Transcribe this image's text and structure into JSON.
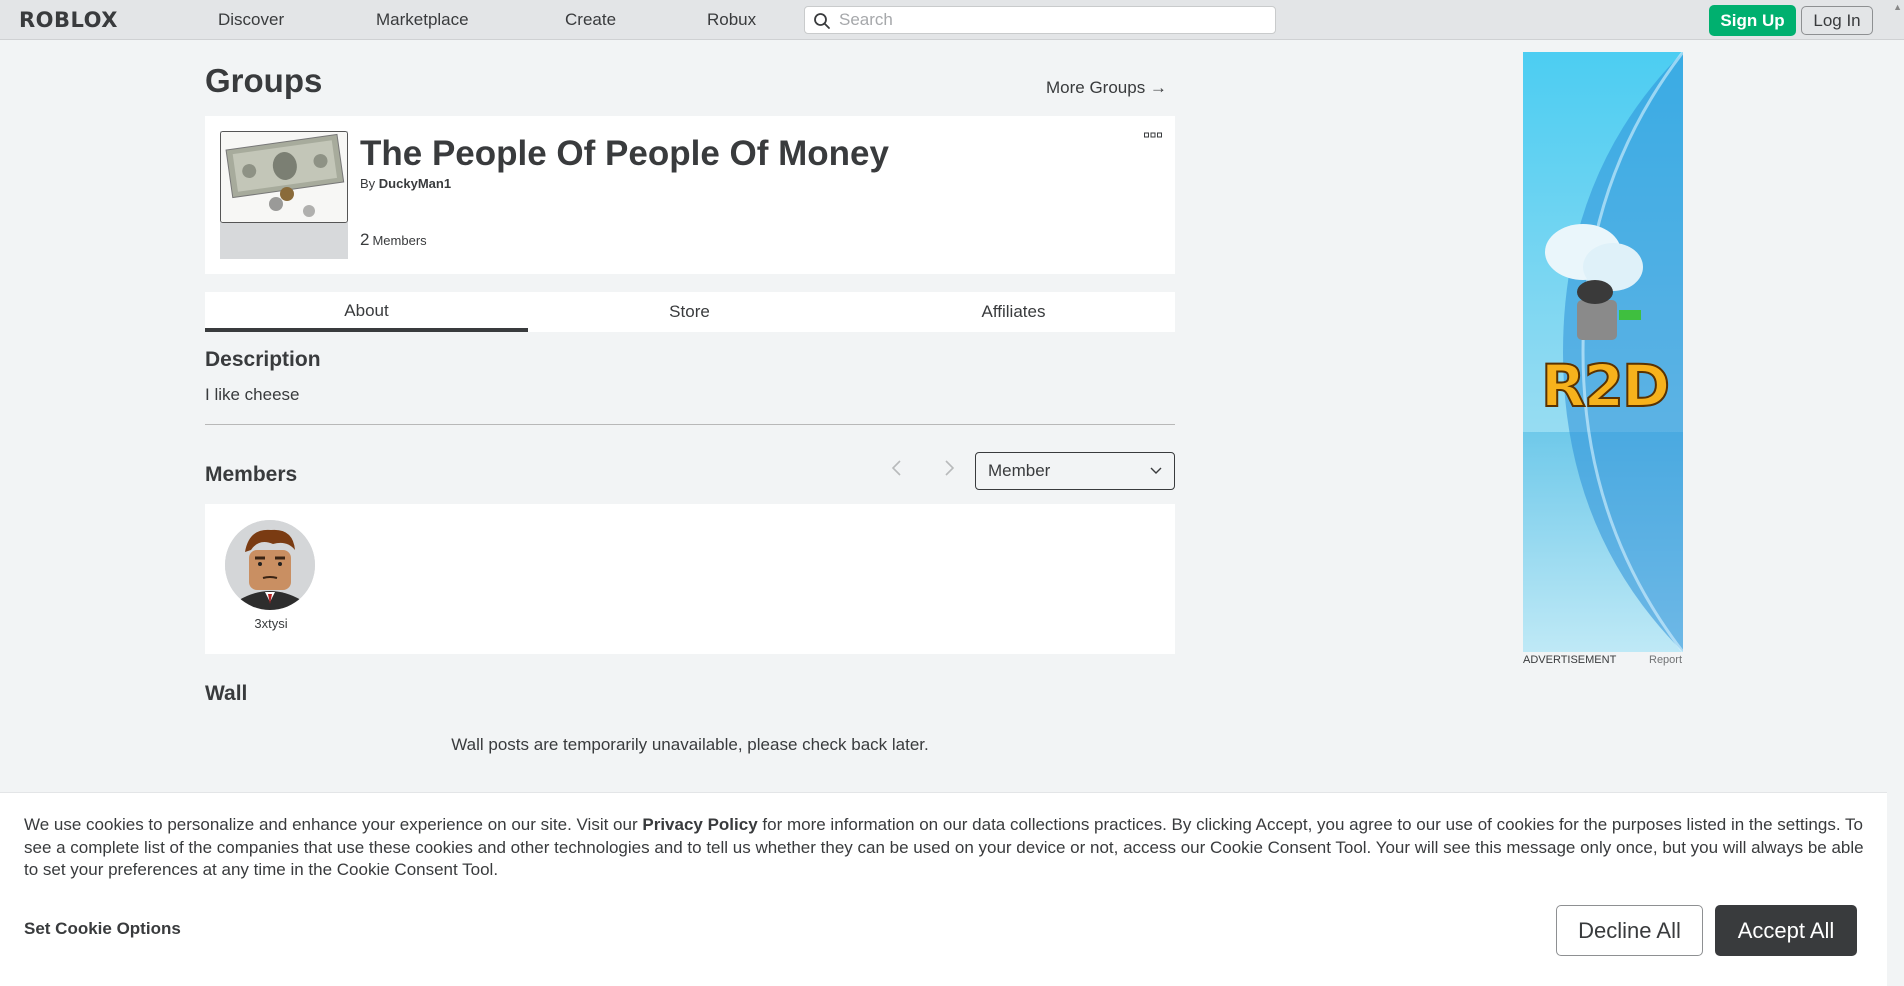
{
  "topnav": {
    "logo": "ROBLOX",
    "links": [
      "Discover",
      "Marketplace",
      "Create",
      "Robux"
    ],
    "search_placeholder": "Search",
    "signup_label": "Sign Up",
    "login_label": "Log In"
  },
  "page": {
    "title": "Groups",
    "more_groups": "More Groups →"
  },
  "group": {
    "name": "The People Of People Of Money",
    "by_prefix": "By",
    "owner": "DuckyMan1",
    "member_count": "2",
    "member_label": "Members"
  },
  "tabs": [
    "About",
    "Store",
    "Affiliates"
  ],
  "about": {
    "description_heading": "Description",
    "description_text": "I like cheese",
    "members_heading": "Members",
    "role_selected": "Member",
    "members": [
      {
        "name": "3xtysi"
      }
    ],
    "wall_heading": "Wall",
    "wall_message": "Wall posts are temporarily unavailable, please check back later."
  },
  "ad": {
    "label": "ADVERTISEMENT",
    "report": "Report",
    "logo_text": "R2D"
  },
  "cookie": {
    "text_before": "We use cookies to personalize and enhance your experience on our site. Visit our ",
    "privacy_link": "Privacy Policy",
    "text_after": " for more information on our data collections practices. By clicking Accept, you agree to our use of cookies for the purposes listed in the settings. To see a complete list of the companies that use these cookies and other technologies and to tell us whether they can be used on your device or not, access our Cookie Consent Tool. Your will see this message only once, but you will always be able to set your preferences at any time in the Cookie Consent Tool.",
    "set_options": "Set Cookie Options",
    "decline": "Decline All",
    "accept": "Accept All"
  },
  "colors": {
    "signup_green": "#00b06f",
    "page_bg": "#f2f4f5",
    "text_dark": "#393b3d"
  }
}
